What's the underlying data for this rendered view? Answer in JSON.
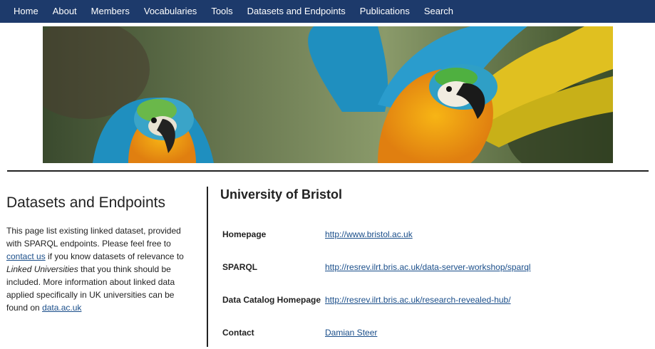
{
  "nav": {
    "items": [
      "Home",
      "About",
      "Members",
      "Vocabularies",
      "Tools",
      "Datasets and Endpoints",
      "Publications",
      "Search"
    ]
  },
  "banner": {
    "icon": "parrots-banner-image"
  },
  "sidebar": {
    "title": "Datasets and Endpoints",
    "text1": "This page list existing linked dataset, provided with SPARQL endpoints. Please feel free to",
    "contact_link": "contact us",
    "text2": " if you know datasets of relevance to",
    "italic": "Linked Universities",
    "text3": " that you think should be included. More information about linked data applied specifically in UK universities can be found on",
    "data_link": "data.ac.uk"
  },
  "main": {
    "title": "University of Bristol",
    "rows": [
      {
        "label": "Homepage",
        "value": "http://www.bristol.ac.uk"
      },
      {
        "label": "SPARQL",
        "value": "http://resrev.ilrt.bris.ac.uk/data-server-workshop/sparql"
      },
      {
        "label": "Data Catalog Homepage",
        "value": "http://resrev.ilrt.bris.ac.uk/research-revealed-hub/"
      },
      {
        "label": "Contact",
        "value": "Damian Steer"
      }
    ]
  },
  "colors": {
    "nav_bg": "#1d3a6b",
    "link": "#1a4e8a"
  }
}
